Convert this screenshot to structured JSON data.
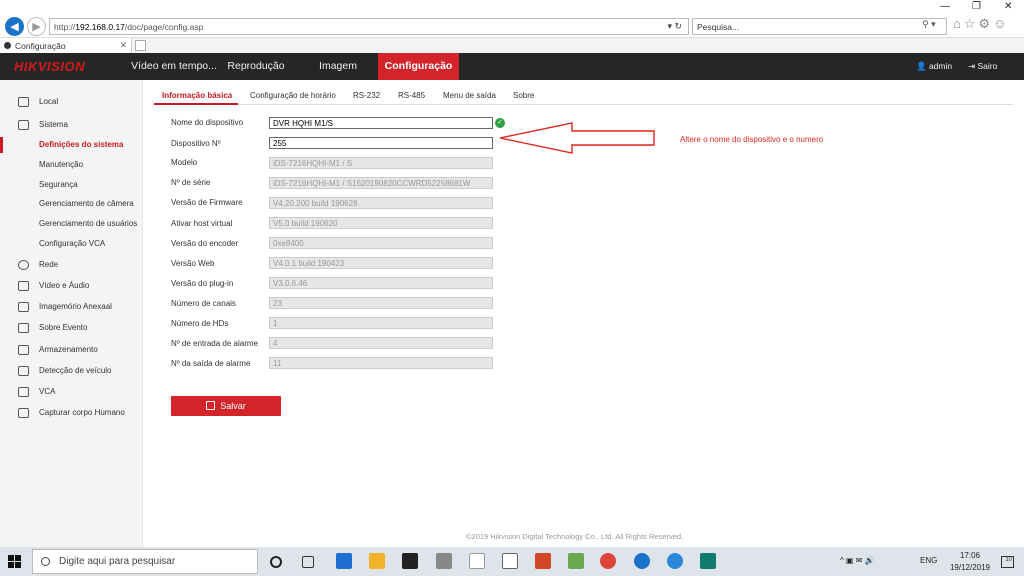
{
  "browser": {
    "window_controls": [
      "—",
      "❐",
      "✕"
    ],
    "url_prefix": "http://",
    "url_host": "192.168.0.17",
    "url_path": "/doc/page/config.asp",
    "url_actions": "▾ ↻",
    "search_placeholder": "Pesquisa...",
    "search_actions": "⚲ ▾",
    "tab_title": "Configuração",
    "tab_close": "✕"
  },
  "header": {
    "logo": "HIKVISION",
    "nav": [
      {
        "label": "Vídeo em tempo..."
      },
      {
        "label": "Reprodução"
      },
      {
        "label": "Imagem"
      },
      {
        "label": "Configuração"
      }
    ],
    "user": "admin",
    "logout": "Sairo"
  },
  "sidebar": {
    "items": [
      {
        "label": "Local"
      },
      {
        "label": "Sistema"
      },
      {
        "label": "Definições do sistema"
      },
      {
        "label": "Manutenção"
      },
      {
        "label": "Segurança"
      },
      {
        "label": "Gerenciamento de câmera"
      },
      {
        "label": "Gerenciamento de usuários"
      },
      {
        "label": "Configuração VCA"
      },
      {
        "label": "Rede"
      },
      {
        "label": "Vídeo e Áudio"
      },
      {
        "label": "Imagemório Anexaal"
      },
      {
        "label": "Sobre Evento"
      },
      {
        "label": "Armazenamento"
      },
      {
        "label": "Detecção de veículo"
      },
      {
        "label": "VCA"
      },
      {
        "label": "Capturar corpo Humano"
      }
    ]
  },
  "tabs": [
    {
      "label": "Informação básica"
    },
    {
      "label": "Configuração de horário"
    },
    {
      "label": "RS-232"
    },
    {
      "label": "RS-485"
    },
    {
      "label": "Menu de saída"
    },
    {
      "label": "Sobre"
    }
  ],
  "form": {
    "fields": [
      {
        "label": "Nome do dispositivo",
        "value": "DVR HQHI M1/S"
      },
      {
        "label": "Dispositivo Nº",
        "value": "255"
      },
      {
        "label": "Modelo",
        "value": "iDS-7216HQHI-M1 / S"
      },
      {
        "label": "Nº de série",
        "value": "iDS-7216HQHI-M1 / S1620190820CCWRD52258681W"
      },
      {
        "label": "Versão de Firmware",
        "value": "V4.20.200 build 190628"
      },
      {
        "label": "Ativar host virtual",
        "value": "V5.0 build 190620"
      },
      {
        "label": "Versão do encoder",
        "value": "0xe8400"
      },
      {
        "label": "Versão Web",
        "value": "V4.0.1 build 190423"
      },
      {
        "label": "Versão do plug-in",
        "value": "V3.0.6.46"
      },
      {
        "label": "Número de canais",
        "value": "23"
      },
      {
        "label": "Número de HDs",
        "value": "1"
      },
      {
        "label": "Nº de entrada de alarme",
        "value": "4"
      },
      {
        "label": "Nº da saída de alarme",
        "value": "11"
      }
    ],
    "save_label": "Salvar"
  },
  "annotation": "Altere o nome do dispositivo e o numero",
  "footer": "©2019 Hikvision Digital Technology Co., Ltd. All Rights Reserved.",
  "taskbar": {
    "search_placeholder": "Digite aqui para pesquisar",
    "tray": "^ ▣ ✉ 🔊",
    "language": "ENG",
    "time": "17:06",
    "date": "19/12/2019",
    "notifications": "10"
  },
  "colors": {
    "accent": "#d3242a",
    "header_bg": "#262626",
    "annotation": "#e0271c"
  }
}
